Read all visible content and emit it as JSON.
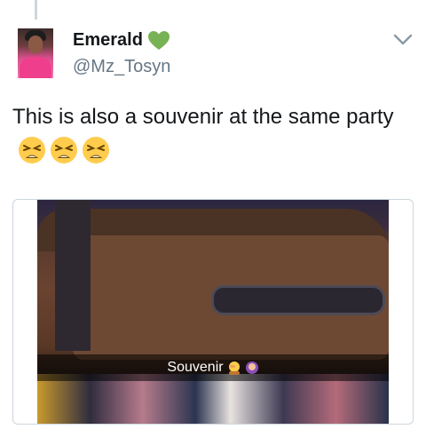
{
  "tweet": {
    "display_name": "Emerald",
    "handle": "@Mz_Tosyn",
    "text": "This is also a souvenir at the same party",
    "emoji": [
      "tired-face-emoji",
      "tired-face-emoji",
      "tired-face-emoji"
    ],
    "verified_icon": "green-heart-icon",
    "colors": {
      "heart": "#77b255",
      "emoji_face": "#ffcc4d",
      "handle": "#657786",
      "border": "#ccd6dd"
    }
  },
  "media": {
    "caption": "Souvenir",
    "caption_emoji": [
      "person-facepalming-emoji",
      "person-icon-emoji"
    ]
  }
}
